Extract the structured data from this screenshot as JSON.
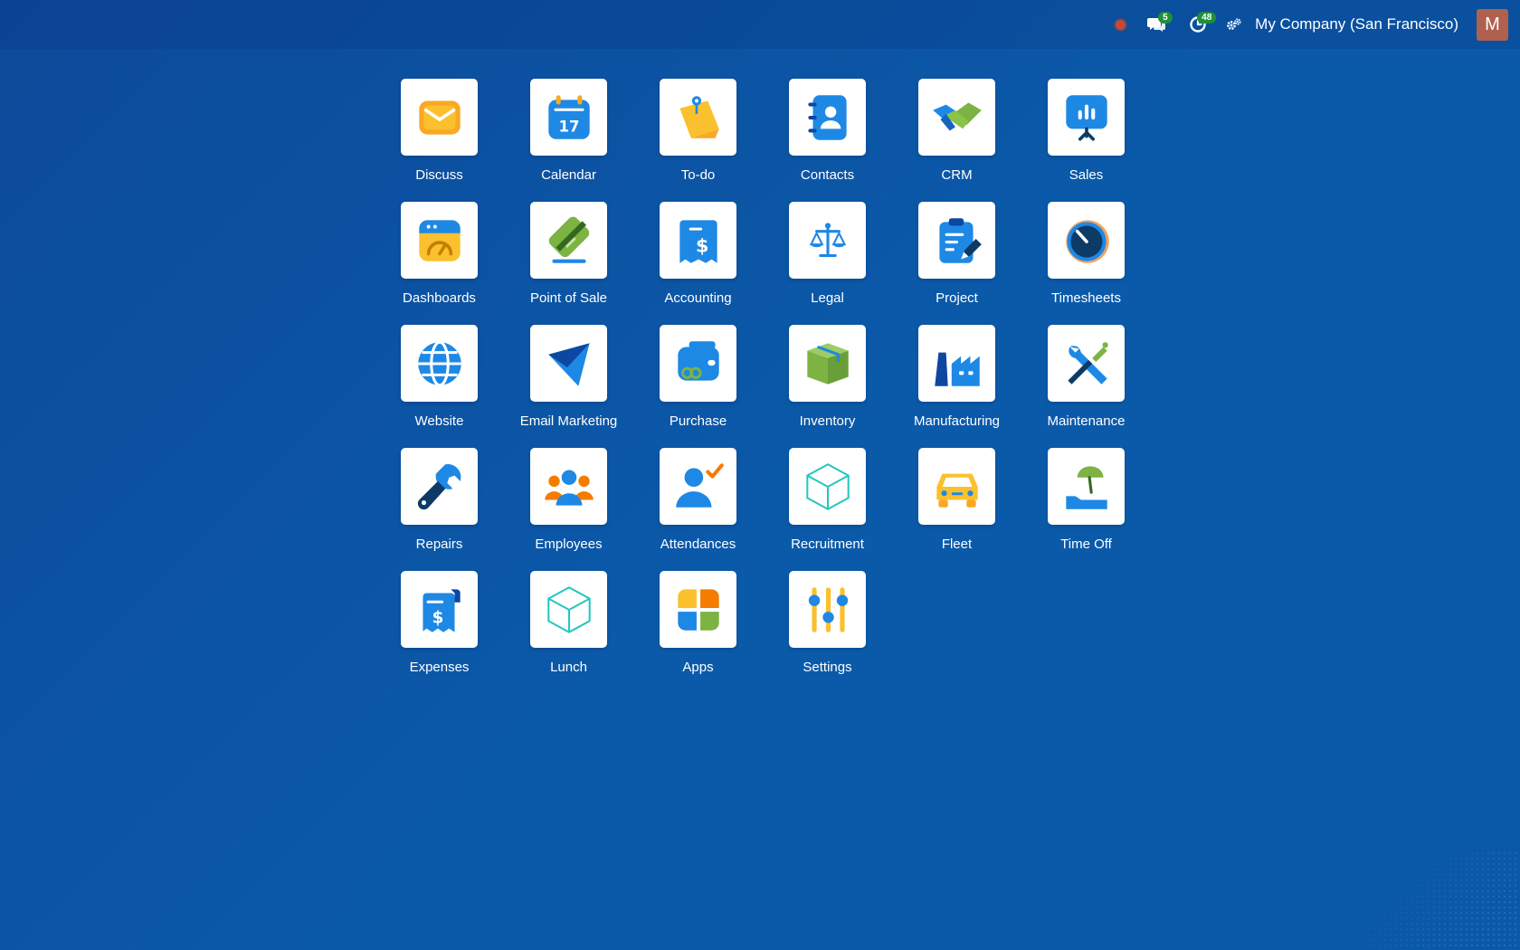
{
  "systray": {
    "message_count": "5",
    "activity_count": "48",
    "company_name": "My Company (San Francisco)",
    "user_initial": "M"
  },
  "colors": {
    "background": "#0b5aaa",
    "badge": "#1f8f3a",
    "avatar": "#b0614d",
    "status_dot": "#c44a36"
  },
  "apps": [
    {
      "label": "Discuss",
      "icon": "discuss-icon"
    },
    {
      "label": "Calendar",
      "icon": "calendar-icon"
    },
    {
      "label": "To-do",
      "icon": "todo-icon"
    },
    {
      "label": "Contacts",
      "icon": "contacts-icon"
    },
    {
      "label": "CRM",
      "icon": "crm-icon"
    },
    {
      "label": "Sales",
      "icon": "sales-icon"
    },
    {
      "label": "Dashboards",
      "icon": "dashboards-icon"
    },
    {
      "label": "Point of Sale",
      "icon": "point-of-sale-icon"
    },
    {
      "label": "Accounting",
      "icon": "accounting-icon"
    },
    {
      "label": "Legal",
      "icon": "legal-icon"
    },
    {
      "label": "Project",
      "icon": "project-icon"
    },
    {
      "label": "Timesheets",
      "icon": "timesheets-icon"
    },
    {
      "label": "Website",
      "icon": "website-icon"
    },
    {
      "label": "Email Marketing",
      "icon": "email-marketing-icon"
    },
    {
      "label": "Purchase",
      "icon": "purchase-icon"
    },
    {
      "label": "Inventory",
      "icon": "inventory-icon"
    },
    {
      "label": "Manufacturing",
      "icon": "manufacturing-icon"
    },
    {
      "label": "Maintenance",
      "icon": "maintenance-icon"
    },
    {
      "label": "Repairs",
      "icon": "repairs-icon"
    },
    {
      "label": "Employees",
      "icon": "employees-icon"
    },
    {
      "label": "Attendances",
      "icon": "attendances-icon"
    },
    {
      "label": "Recruitment",
      "icon": "recruitment-icon"
    },
    {
      "label": "Fleet",
      "icon": "fleet-icon"
    },
    {
      "label": "Time Off",
      "icon": "time-off-icon"
    },
    {
      "label": "Expenses",
      "icon": "expenses-icon"
    },
    {
      "label": "Lunch",
      "icon": "lunch-icon"
    },
    {
      "label": "Apps",
      "icon": "apps-icon"
    },
    {
      "label": "Settings",
      "icon": "settings-icon"
    }
  ]
}
